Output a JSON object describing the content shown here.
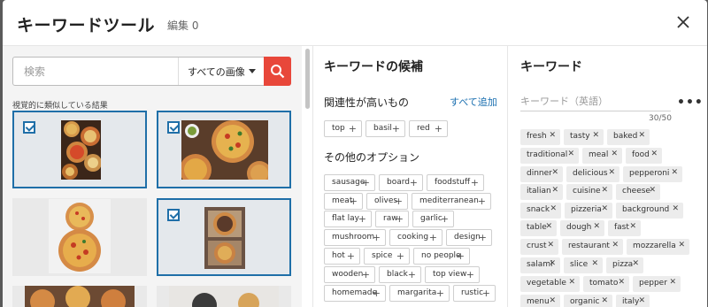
{
  "header": {
    "title": "キーワードツール",
    "edit_label": "編集 0"
  },
  "search": {
    "placeholder": "検索",
    "value": "",
    "filter_label": "すべての画像",
    "similar_label": "視覚的に類似している結果"
  },
  "suggestions": {
    "title": "キーワードの候補",
    "relevance_label": "関連性が高いもの",
    "add_all_label": "すべて追加",
    "relevant": [
      "top",
      "basil",
      "red"
    ],
    "other_label": "その他のオプション",
    "other": [
      "sausage",
      "board",
      "foodstuff",
      "meat",
      "olives",
      "mediterranean",
      "flat lay",
      "raw",
      "garlic",
      "mushroom",
      "cooking",
      "design",
      "hot",
      "spice",
      "no people",
      "wooden",
      "black",
      "top view",
      "homemade",
      "margarita",
      "rustic"
    ]
  },
  "keywords": {
    "title": "キーワード",
    "placeholder": "キーワード（英語）",
    "count": "30/50",
    "items": [
      "fresh",
      "tasty",
      "baked",
      "traditional",
      "meal",
      "food",
      "dinner",
      "delicious",
      "pepperoni",
      "italian",
      "cuisine",
      "cheese",
      "snack",
      "pizzeria",
      "background",
      "table",
      "dough",
      "fast",
      "crust",
      "restaurant",
      "mozzarella",
      "salami",
      "slice",
      "pizza",
      "vegetable",
      "tomato",
      "pepper",
      "menu",
      "organic",
      "italy"
    ]
  },
  "colors": {
    "accent_red": "#e8473a",
    "selection_blue": "#1f6fa8",
    "link_blue": "#1a6fb0"
  },
  "icons": {
    "close": "close-icon",
    "search": "search-icon",
    "check": "checkbox-checked-icon",
    "more": "more-horizontal-icon",
    "chip_add": "plus-icon",
    "tag_remove": "x-icon"
  },
  "grid": {
    "selected": [
      true,
      true,
      false,
      true,
      false,
      false
    ]
  }
}
